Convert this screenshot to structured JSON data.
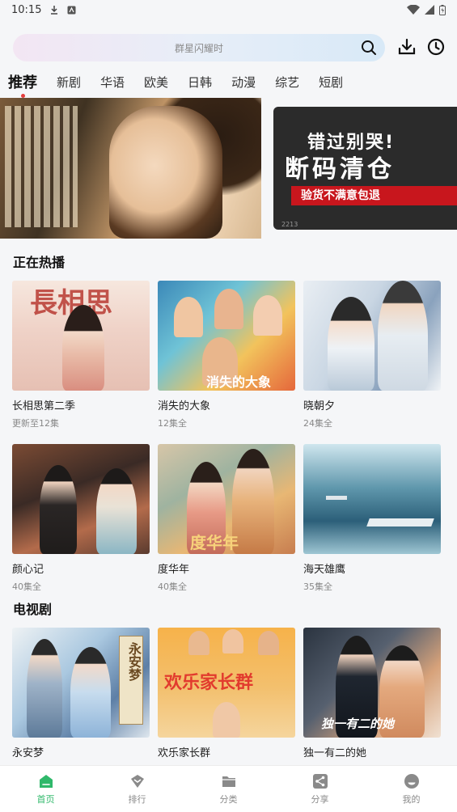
{
  "status_bar": {
    "time": "10:15"
  },
  "search": {
    "placeholder": "群星闪耀时"
  },
  "tabs": [
    {
      "label": "推荐",
      "active": true
    },
    {
      "label": "新剧"
    },
    {
      "label": "华语"
    },
    {
      "label": "欧美"
    },
    {
      "label": "日韩"
    },
    {
      "label": "动漫"
    },
    {
      "label": "综艺"
    },
    {
      "label": "短剧"
    }
  ],
  "banner": {
    "side_ad": {
      "line1": "错过别哭!",
      "line2": "断码清仓",
      "line3": "验货不满意包退",
      "tag": "2213"
    }
  },
  "sections": [
    {
      "title": "正在热播",
      "items": [
        {
          "title": "长相思第二季",
          "sub": "更新至12集",
          "poster_text": "長相思"
        },
        {
          "title": "消失的大象",
          "sub": "12集全",
          "poster_text": "消失的大象"
        },
        {
          "title": "晓朝夕",
          "sub": "24集全",
          "poster_text": ""
        },
        {
          "title": "颜心记",
          "sub": "40集全",
          "poster_text": ""
        },
        {
          "title": "度华年",
          "sub": "40集全",
          "poster_text": "度华年"
        },
        {
          "title": "海天雄鹰",
          "sub": "35集全",
          "poster_text": ""
        }
      ]
    },
    {
      "title": "电视剧",
      "items": [
        {
          "title": "永安梦",
          "sub": "",
          "poster_text": "永安梦"
        },
        {
          "title": "欢乐家长群",
          "sub": "",
          "poster_text": "欢乐家长群"
        },
        {
          "title": "独一有二的她",
          "sub": "",
          "poster_text": "独一有二的她"
        }
      ]
    }
  ],
  "bottom_nav": [
    {
      "label": "首页",
      "icon": "home-icon",
      "active": true
    },
    {
      "label": "排行",
      "icon": "ranking-icon"
    },
    {
      "label": "分类",
      "icon": "folder-icon"
    },
    {
      "label": "分享",
      "icon": "share-icon"
    },
    {
      "label": "我的",
      "icon": "profile-icon"
    }
  ],
  "colors": {
    "accent": "#2fb86a",
    "active_dot": "#e43d3d"
  }
}
